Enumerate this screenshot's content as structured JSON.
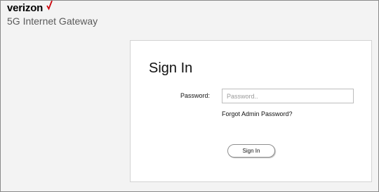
{
  "header": {
    "brand": "verizon",
    "brand_accent_color": "#cd040b",
    "subtitle": "5G Internet Gateway"
  },
  "signin": {
    "title": "Sign In",
    "password_label": "Password:",
    "password_placeholder": "Password..",
    "password_value": "",
    "forgot_link": "Forgot Admin Password?",
    "submit_label": "Sign In"
  }
}
